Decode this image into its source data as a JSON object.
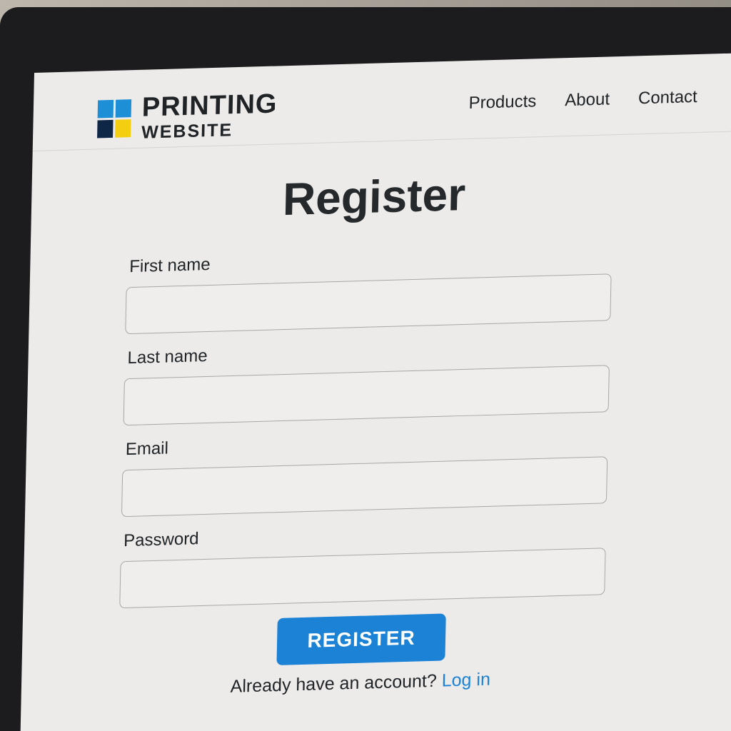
{
  "brand": {
    "line1": "PRINTING",
    "line2": "WEBSITE",
    "colors": {
      "blue": "#1c8fd6",
      "navy": "#0f2747",
      "yellow": "#f4cf11"
    }
  },
  "nav": {
    "items": [
      {
        "label": "Products"
      },
      {
        "label": "About"
      },
      {
        "label": "Contact"
      }
    ]
  },
  "page": {
    "title": "Register"
  },
  "form": {
    "fields": [
      {
        "label": "First name",
        "value": "",
        "placeholder": ""
      },
      {
        "label": "Last name",
        "value": "",
        "placeholder": ""
      },
      {
        "label": "Email",
        "value": "",
        "placeholder": ""
      },
      {
        "label": "Password",
        "value": "",
        "placeholder": ""
      }
    ],
    "submit_label": "REGISTER",
    "submit_color": "#1b82d6"
  },
  "footer": {
    "prompt": "Already have an account?",
    "login_link": "Log in"
  }
}
